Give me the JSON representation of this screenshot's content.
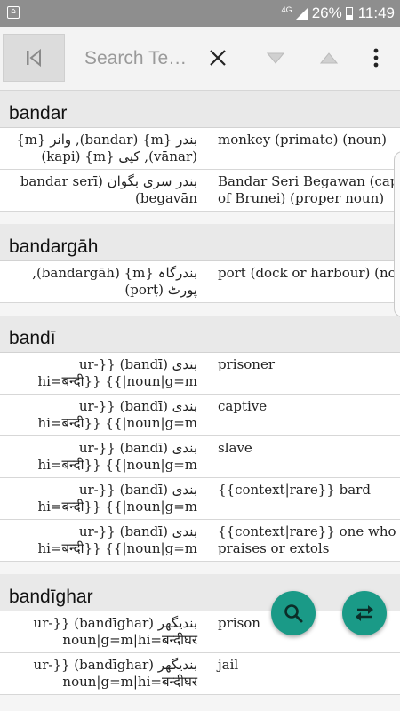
{
  "status_bar": {
    "network": "4G",
    "battery_pct": "26%",
    "time": "11:49"
  },
  "toolbar": {
    "search_placeholder": "Search Te…",
    "icons": [
      "skip-back-icon",
      "close-icon",
      "arrow-down-icon",
      "arrow-up-icon",
      "more-vert-icon"
    ]
  },
  "results": [
    {
      "headword": "bandar",
      "rows": [
        {
          "source": "بندر {m} (bandar), وانر {m} (vānar), کپی {m} (kapi)",
          "target_lines": [
            "monkey (primate) (noun)"
          ]
        },
        {
          "source": "بندر سری بگوان (bandar serī begavān)",
          "target_lines": [
            "Bandar Seri Begawan (capital",
            "of Brunei) (proper noun)"
          ]
        }
      ]
    },
    {
      "headword": "bandargāh",
      "rows": [
        {
          "source": "بندرگاہ {m} (bandargāh), پورٹ (porṭ)",
          "target_lines": [
            "port (dock or harbour) (noun)"
          ]
        }
      ]
    },
    {
      "headword": "bandī",
      "rows": [
        {
          "source": "بندی (bandī) {{ur-noun|g=m|}} {{hi=बन्दी",
          "target_lines": [
            "prisoner"
          ]
        },
        {
          "source": "بندی (bandī) {{ur-noun|g=m|}} {{hi=बन्दी",
          "target_lines": [
            "captive"
          ]
        },
        {
          "source": "بندی (bandī) {{ur-noun|g=m|}} {{hi=बन्दी",
          "target_lines": [
            "slave"
          ]
        },
        {
          "source": "بندی (bandī) {{ur-noun|g=m|}} {{hi=बन्दी",
          "target_lines": [
            "{{context|rare}} bard"
          ]
        },
        {
          "source": "بندی (bandī) {{ur-noun|g=m|}} {{hi=बन्दी",
          "target_lines": [
            "{{context|rare}} one who",
            "praises or extols"
          ]
        }
      ]
    },
    {
      "headword": "bandīghar",
      "rows": [
        {
          "source": "بندیگھر (bandīghar) {{ur-noun|g=m|hi=बन्दीघर",
          "target_lines": [
            "prison"
          ]
        },
        {
          "source": "بندیگھر (bandīghar) {{ur-noun|g=m|hi=बन्दीघर",
          "target_lines": [
            "jail"
          ]
        }
      ]
    }
  ],
  "fabs": {
    "search_icon": "search-icon",
    "swap_icon": "swap-icon",
    "color": "#1a9a87"
  }
}
